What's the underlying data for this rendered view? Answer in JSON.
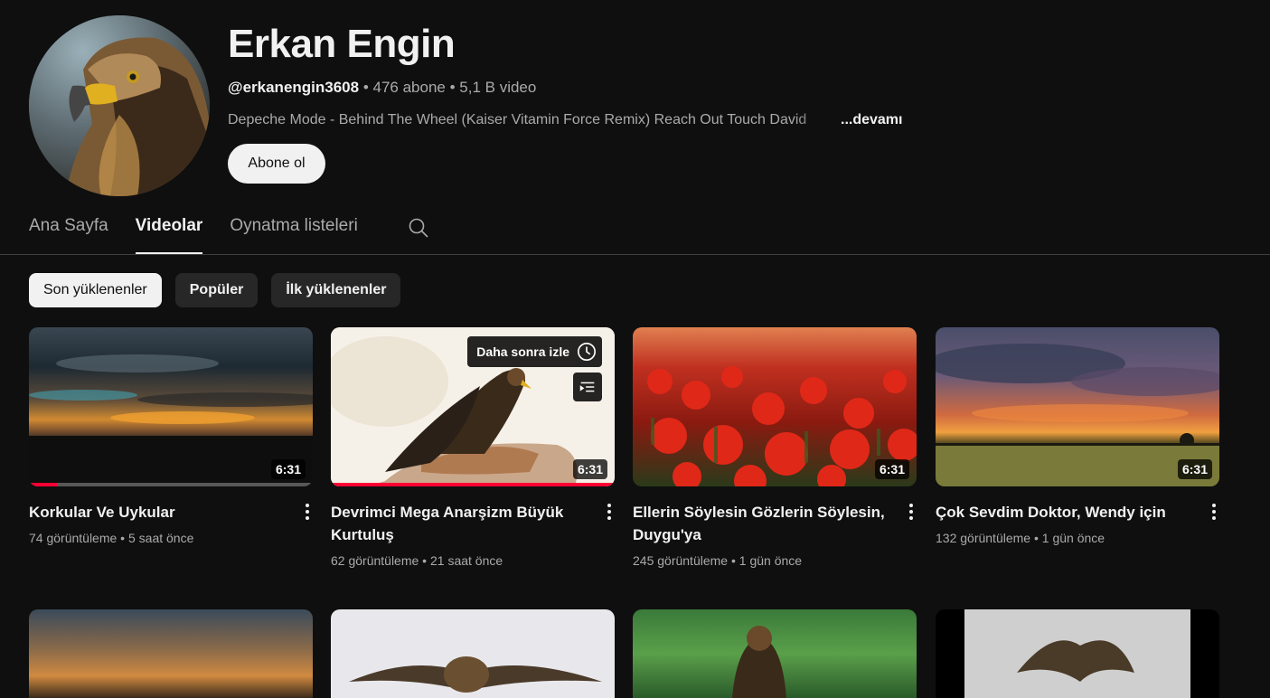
{
  "channel": {
    "name": "Erkan Engin",
    "handle": "@erkanengin3608",
    "subscribers": "476 abone",
    "video_count": "5,1 B video",
    "separator": " • ",
    "description": "Depeche Mode - Behind The Wheel (Kaiser Vitamin Force Remix) Reach Out Touch David",
    "more_label": "...devamı",
    "subscribe_label": "Abone ol"
  },
  "tabs": [
    {
      "label": "Ana Sayfa"
    },
    {
      "label": "Videolar"
    },
    {
      "label": "Oynatma listeleri"
    }
  ],
  "chips": [
    {
      "label": "Son yüklenenler"
    },
    {
      "label": "Popüler"
    },
    {
      "label": "İlk yüklenenler"
    }
  ],
  "hover": {
    "watch_later_label": "Daha sonra izle"
  },
  "videos": [
    {
      "title": "Korkular Ve Uykular",
      "duration": "6:31",
      "views": "74 görüntüleme",
      "age": "5 saat önce",
      "progress": 0.1
    },
    {
      "title": "Devrimci Mega Anarşizm Büyük Kurtuluş",
      "duration": "6:31",
      "views": "62 görüntüleme",
      "age": "21 saat önce",
      "progress": 1.0
    },
    {
      "title": "Ellerin Söylesin Gözlerin Söylesin, Duygu'ya",
      "duration": "6:31",
      "views": "245 görüntüleme",
      "age": "1 gün önce"
    },
    {
      "title": "Çok Sevdim Doktor, Wendy için",
      "duration": "6:31",
      "views": "132 görüntüleme",
      "age": "1 gün önce"
    }
  ]
}
